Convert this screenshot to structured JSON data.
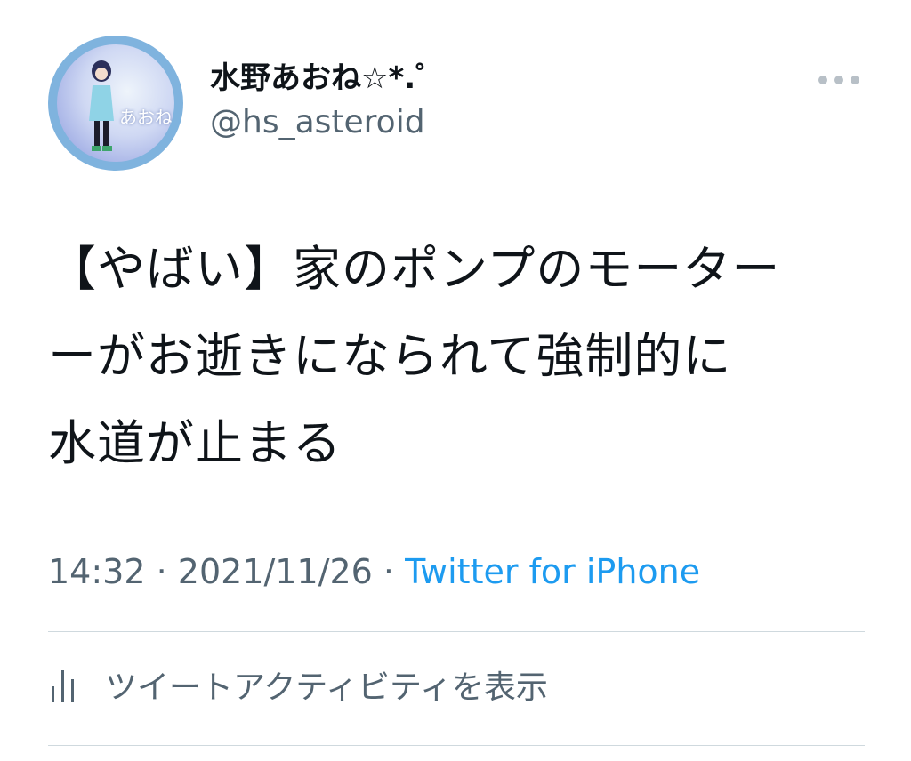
{
  "user": {
    "display_name": "水野あおね☆*.゜",
    "handle": "@hs_asteroid",
    "avatar_text": "あおね",
    "avatar_icon": "profile-avatar"
  },
  "more_icon": "ellipsis-icon",
  "tweet": {
    "text": "【やばい】家のポンプのモーター\nーがお逝きになられて強制的に\n水道が止まる",
    "time": "14:32",
    "date": "2021/11/26",
    "separator": "·",
    "source": "Twitter for iPhone"
  },
  "activity": {
    "label": "ツイートアクティビティを表示",
    "icon": "bar-chart-icon"
  },
  "colors": {
    "text": "#0f1419",
    "secondary": "#536471",
    "link": "#1d9bf0",
    "divider": "#cfd9de"
  }
}
